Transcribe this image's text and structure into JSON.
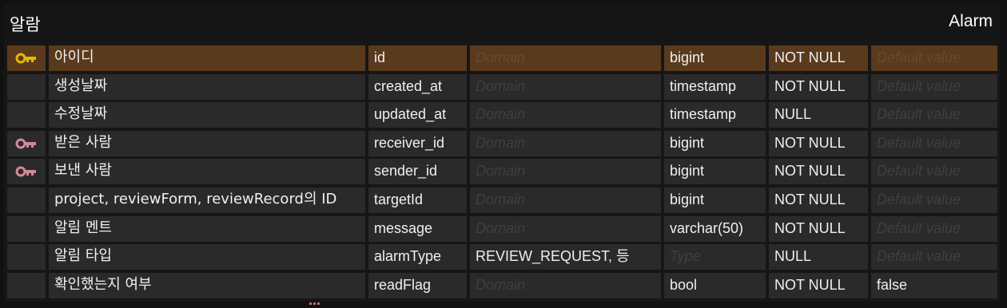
{
  "entity": {
    "logical_name": "알람",
    "physical_name": "Alarm",
    "colors": {
      "primary_key": "#e6b800",
      "foreign_key": "#d4889a",
      "selected_row": "#5a3a1c"
    },
    "columns": [
      {
        "key": "primary-key-icon",
        "logical": "아이디",
        "physical": "id",
        "domain": "Domain",
        "type": "bigint",
        "null": "NOT NULL",
        "default": "Default value",
        "selected": true
      },
      {
        "key": "",
        "logical": "생성날짜",
        "physical": "created_at",
        "domain": "Domain",
        "type": "timestamp",
        "null": "NOT NULL",
        "default": "Default value"
      },
      {
        "key": "",
        "logical": "수정날짜",
        "physical": "updated_at",
        "domain": "Domain",
        "type": "timestamp",
        "null": "NULL",
        "default": "Default value"
      },
      {
        "key": "foreign-key-icon",
        "logical": "받은 사람",
        "physical": "receiver_id",
        "domain": "Domain",
        "type": "bigint",
        "null": "NOT NULL",
        "default": "Default value"
      },
      {
        "key": "foreign-key-icon",
        "logical": "보낸 사람",
        "physical": "sender_id",
        "domain": "Domain",
        "type": "bigint",
        "null": "NOT NULL",
        "default": "Default value"
      },
      {
        "key": "",
        "logical": "project, reviewForm, reviewRecord의 ID",
        "physical": "targetId",
        "domain": "Domain",
        "type": "bigint",
        "null": "NOT NULL",
        "default": "Default value"
      },
      {
        "key": "",
        "logical": "알림 멘트",
        "physical": "message",
        "domain": "Domain",
        "type": "varchar(50)",
        "null": "NOT NULL",
        "default": "Default value"
      },
      {
        "key": "",
        "logical": "알림 타입",
        "physical": "alarmType",
        "domain": "REVIEW_REQUEST, 등",
        "domain_filled": true,
        "type": "Type",
        "type_placeholder": true,
        "null": "NULL",
        "default": "Default value"
      },
      {
        "key": "",
        "logical": "확인했는지 여부",
        "physical": "readFlag",
        "domain": "Domain",
        "type": "bool",
        "null": "NOT NULL",
        "default": "false",
        "default_filled": true
      }
    ]
  }
}
